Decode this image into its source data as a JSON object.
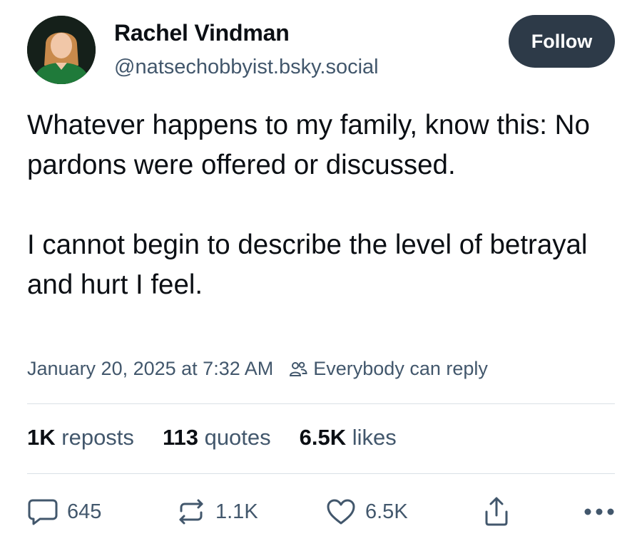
{
  "author": {
    "display_name": "Rachel Vindman",
    "handle": "@natsechobbyist.bsky.social",
    "avatar": "avatar-photo"
  },
  "follow_button": {
    "label": "Follow"
  },
  "post": {
    "paragraphs": [
      "Whatever happens to my family, know this: No pardons were offered or discussed.",
      "I cannot begin to describe the level of betrayal and hurt I feel."
    ],
    "timestamp": "January 20, 2025 at 7:32 AM",
    "reply_setting": "Everybody can reply",
    "reply_setting_icon": "people-icon"
  },
  "stats": {
    "reposts": {
      "count": "1K",
      "label": "reposts"
    },
    "quotes": {
      "count": "113",
      "label": "quotes"
    },
    "likes": {
      "count": "6.5K",
      "label": "likes"
    }
  },
  "actions": {
    "reply": {
      "icon": "reply-bubble-icon",
      "count": "645"
    },
    "repost": {
      "icon": "repost-icon",
      "count": "1.1K"
    },
    "like": {
      "icon": "heart-icon",
      "count": "6.5K"
    },
    "share": {
      "icon": "share-icon"
    },
    "more": {
      "icon": "more-dots-icon"
    }
  },
  "colors": {
    "text_primary": "#0b0f14",
    "text_secondary": "#42576c",
    "follow_bg": "#2d3a48",
    "divider": "#d9e0e6"
  }
}
